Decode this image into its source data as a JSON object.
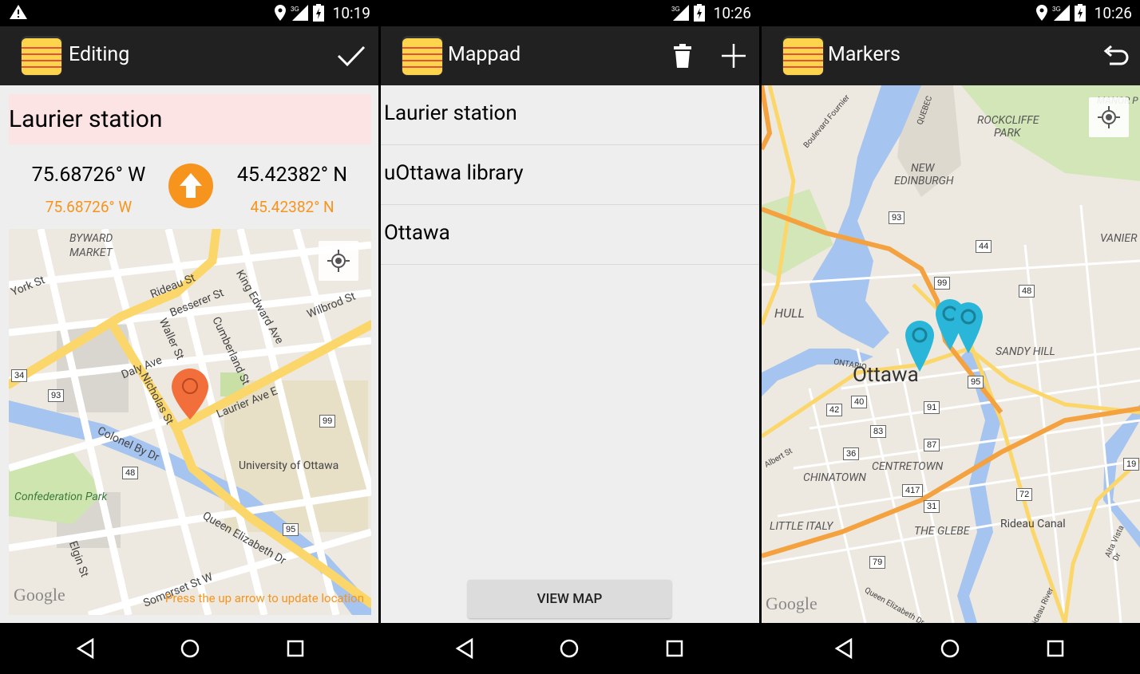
{
  "screens": [
    {
      "status_time": "10:19",
      "title": "Editing",
      "name_value": "Laurier station",
      "lon_big": "75.68726° W",
      "lon_small": "75.68726° W",
      "lat_big": "45.42382° N",
      "lat_small": "45.42382° N",
      "hint": "Press the up arrow to update location",
      "map_labels": {
        "byward": "BYWARD",
        "market": "MARKET",
        "york": "York St",
        "rideau": "Rideau St",
        "besserer": "Besserer St",
        "king_edward": "King Edward Ave",
        "wilbrod": "Wilbrod St",
        "waller": "Waller St",
        "cumberland": "Cumberland St",
        "daly": "Daly Ave",
        "nicholas": "Nicholas St",
        "laurier": "Laurier Ave E",
        "colonel_by": "Colonel By Dr",
        "uottawa": "University of Ottawa",
        "confed": "Confederation Park",
        "queen_eliz": "Queen Elizabeth Dr",
        "elgin": "Elgin St",
        "somerset": "Somerset St W",
        "google": "Google",
        "s34": "34",
        "s93": "93",
        "s99": "99",
        "s48": "48",
        "s95": "95"
      }
    },
    {
      "status_time": "10:26",
      "title": "Mappad",
      "items": [
        "Laurier station",
        "uOttawa library",
        "Ottawa"
      ],
      "view_map": "VIEW MAP"
    },
    {
      "status_time": "10:26",
      "title": "Markers",
      "map_labels": {
        "rockcliffe1": "ROCKCLIFFE",
        "rockcliffe2": "PARK",
        "manor": "MANOR P",
        "new_edinburgh1": "NEW",
        "new_edinburgh2": "EDINBURGH",
        "vanier": "VANIER",
        "hull": "HULL",
        "ottawa": "Ottawa",
        "sandy_hill": "SANDY HILL",
        "centretown": "CENTRETOWN",
        "chinatown": "CHINATOWN",
        "little_italy": "LITTLE ITALY",
        "glebe": "THE GLEBE",
        "rideau_canal": "Rideau Canal",
        "boulevard": "Boulevard Fournier",
        "quebec": "QUEBEC",
        "ontario": "ONTARIO",
        "albert": "Albert St",
        "alta_vista": "Alta Vista Dr",
        "rideau_river": "Rideau River",
        "queen_eliz": "Queen Elizabeth Dr",
        "google": "Google",
        "s93": "93",
        "s44": "44",
        "s99": "99",
        "s48": "48",
        "s95": "95",
        "s42": "42",
        "s40": "40",
        "s91": "91",
        "s83": "83",
        "s87": "87",
        "s36": "36",
        "s417": "417",
        "s72": "72",
        "s31": "31",
        "s79": "79",
        "s19": "19"
      }
    }
  ],
  "colors": {
    "accent": "#f7941d",
    "appbar": "#212121",
    "marker_orange": "#f26f3b",
    "marker_blue": "#29b6d8",
    "highlight": "#fce4e4"
  }
}
